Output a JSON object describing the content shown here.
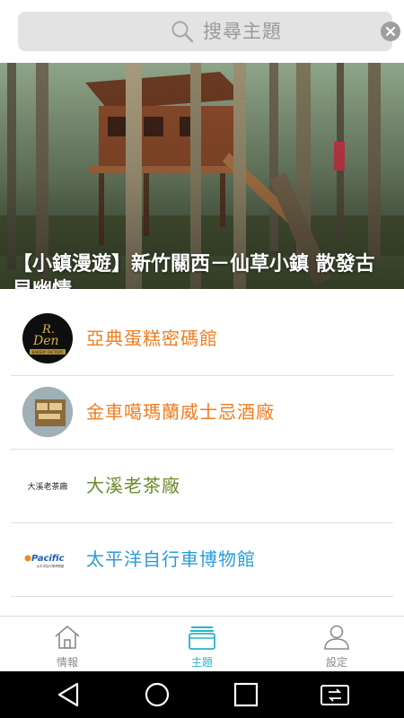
{
  "search": {
    "placeholder": "搜尋主題"
  },
  "banner": {
    "title": "【小鎮漫遊】新竹關西－仙草小鎮 散發古早幽情",
    "slide_count": 5,
    "active_slide": 1
  },
  "list": [
    {
      "label": "亞典蛋糕密碼館",
      "color": "#ef7d1e",
      "logo": "r-den-logo",
      "logo_text": {
        "line1": "R.",
        "line2": "Den",
        "line3": "BAKERY FACTORY"
      }
    },
    {
      "label": "金車噶瑪蘭威士忌酒廠",
      "color": "#ef7d1e",
      "logo": "kavalan-logo"
    },
    {
      "label": "大溪老茶廠",
      "color": "#6b8a2a",
      "logo": "daxi-tea-logo",
      "logo_text": "大溪老茶廠"
    },
    {
      "label": "太平洋自行車博物館",
      "color": "#2a9bd8",
      "logo": "pacific-logo",
      "logo_text": {
        "brand": "Pacific",
        "sub": "太平洋自行車博物館"
      }
    }
  ],
  "bottom_nav": [
    {
      "label": "情報",
      "icon": "home-icon",
      "active": false
    },
    {
      "label": "主題",
      "icon": "folder-icon",
      "active": true
    },
    {
      "label": "設定",
      "icon": "person-icon",
      "active": false
    }
  ],
  "colors": {
    "accent": "#2bb3c7",
    "inactive": "#8a8a8a",
    "search_bg": "#e3e3e3"
  },
  "system_nav": [
    "back-icon",
    "home-circle-icon",
    "recents-icon",
    "screen-switch-icon"
  ]
}
